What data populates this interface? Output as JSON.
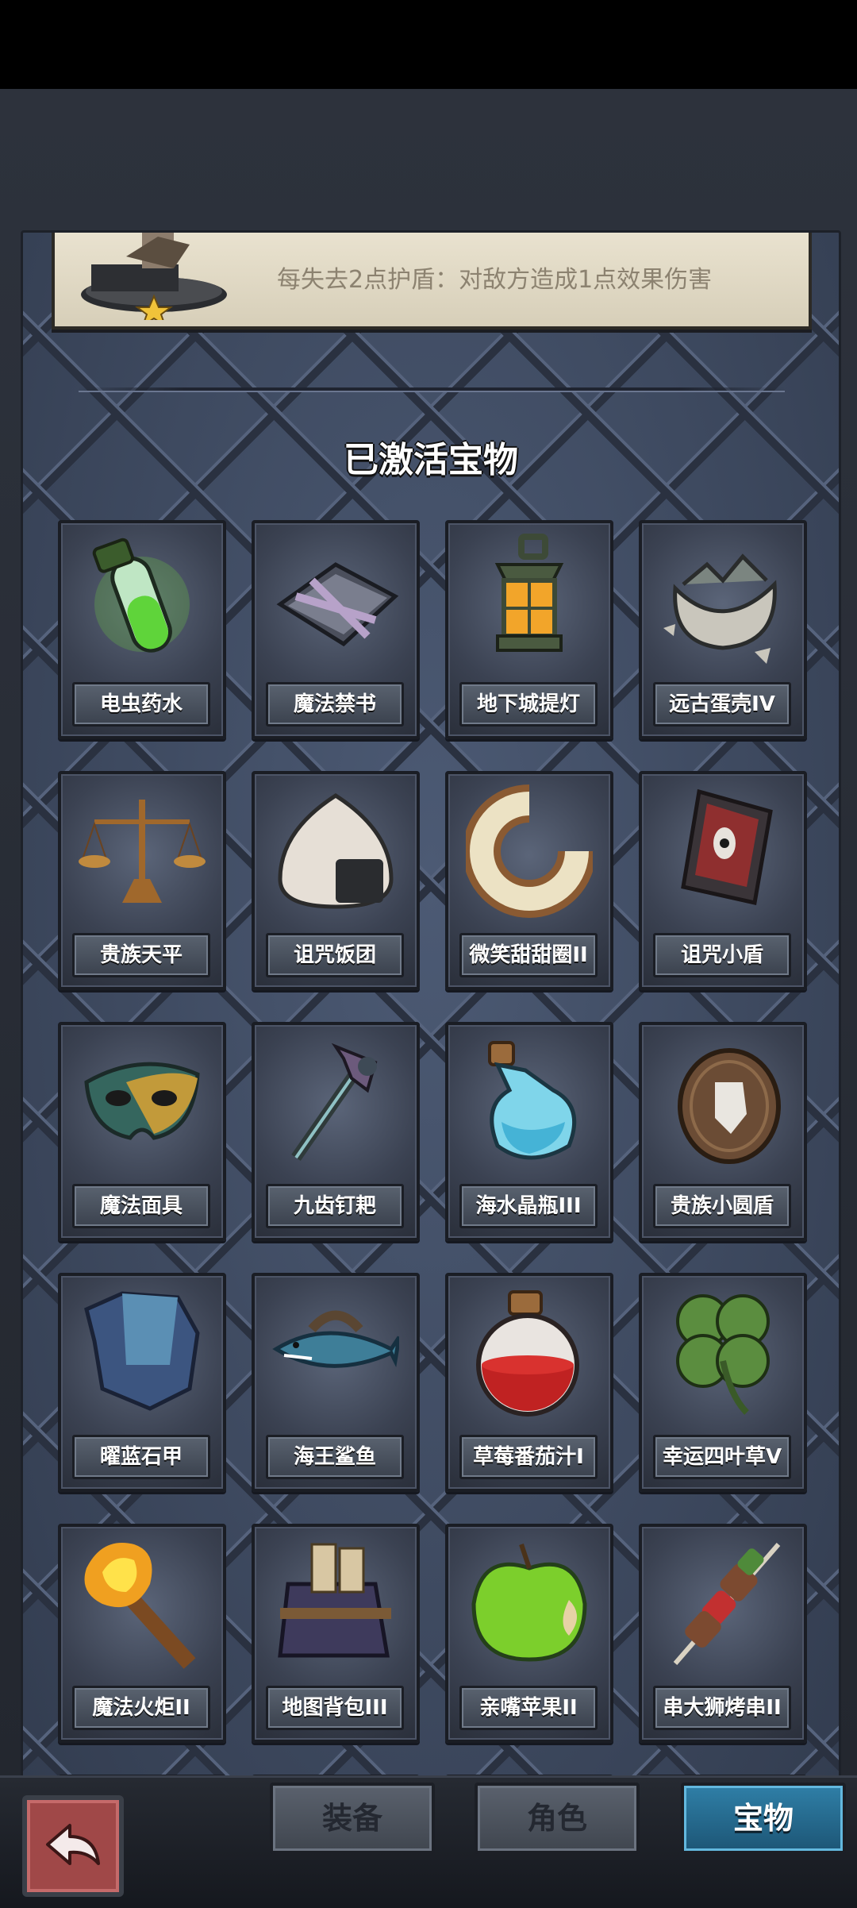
{
  "effect": {
    "text": "每失去2点护盾：对敌方造成1点效果伤害"
  },
  "section_title": "已激活宝物",
  "items": [
    {
      "label": "电虫药水"
    },
    {
      "label": "魔法禁书"
    },
    {
      "label": "地下城提灯"
    },
    {
      "label": "远古蛋壳IV"
    },
    {
      "label": "贵族天平"
    },
    {
      "label": "诅咒饭团"
    },
    {
      "label": "微笑甜甜圈II"
    },
    {
      "label": "诅咒小盾"
    },
    {
      "label": "魔法面具"
    },
    {
      "label": "九齿钉耙"
    },
    {
      "label": "海水晶瓶III"
    },
    {
      "label": "贵族小圆盾"
    },
    {
      "label": "曜蓝石甲"
    },
    {
      "label": "海王鲨鱼"
    },
    {
      "label": "草莓番茄汁I"
    },
    {
      "label": "幸运四叶草V"
    },
    {
      "label": "魔法火炬II"
    },
    {
      "label": "地图背包III"
    },
    {
      "label": "亲嘴苹果II"
    },
    {
      "label": "串大狮烤串II"
    }
  ],
  "tabs": {
    "equipment": "装备",
    "character": "角色",
    "treasure": "宝物"
  },
  "active_tab": "宝物",
  "icons": {
    "back": "back-arrow-icon",
    "star": "star-icon"
  }
}
